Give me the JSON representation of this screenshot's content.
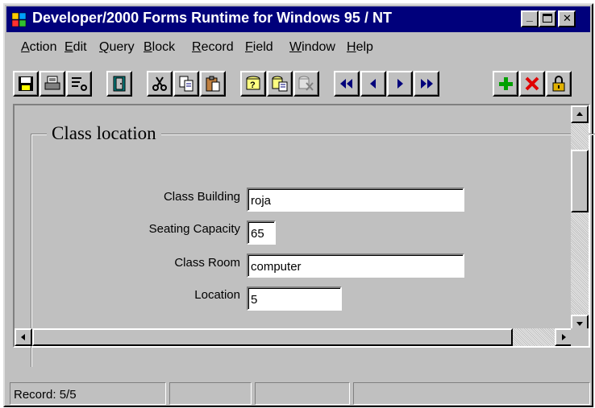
{
  "window": {
    "title": "Developer/2000 Forms Runtime for Windows 95 / NT",
    "minimize_glyph": "_",
    "maximize_glyph": "□",
    "close_glyph": "✕"
  },
  "menu": [
    "Action",
    "Edit",
    "Query",
    "Block",
    "Record",
    "Field",
    "Window",
    "Help"
  ],
  "toolbar": {
    "buttons": [
      {
        "name": "save",
        "icon": "floppy-disk-icon"
      },
      {
        "name": "print",
        "icon": "printer-icon"
      },
      {
        "name": "print-setup",
        "icon": "print-setup-icon"
      },
      {
        "name": "exit",
        "icon": "door-icon"
      },
      {
        "name": "cut",
        "icon": "scissors-icon"
      },
      {
        "name": "copy",
        "icon": "copy-icon"
      },
      {
        "name": "paste",
        "icon": "paste-icon"
      },
      {
        "name": "enter-query",
        "icon": "enter-query-icon"
      },
      {
        "name": "execute-query",
        "icon": "execute-query-icon"
      },
      {
        "name": "cancel-query",
        "icon": "cancel-query-icon"
      },
      {
        "name": "previous-block",
        "icon": "double-left-arrow-icon"
      },
      {
        "name": "previous-record",
        "icon": "left-arrow-icon"
      },
      {
        "name": "next-record",
        "icon": "right-arrow-icon"
      },
      {
        "name": "next-block",
        "icon": "double-right-arrow-icon"
      },
      {
        "name": "insert-record",
        "icon": "green-plus-icon"
      },
      {
        "name": "delete-record",
        "icon": "red-x-icon"
      },
      {
        "name": "lock-record",
        "icon": "padlock-icon"
      }
    ]
  },
  "form": {
    "frame_title": "Class location",
    "fields": {
      "class_building": {
        "label": "Class Building",
        "value": "roja"
      },
      "seating_capacity": {
        "label": "Seating  Capacity",
        "value": "65"
      },
      "class_room": {
        "label": "Class Room",
        "value": "computer"
      },
      "location": {
        "label": "Location",
        "value": "5"
      }
    }
  },
  "status": {
    "record": "Record: 5/5"
  },
  "colors": {
    "titlebar": "#00007b",
    "face": "#c0c0c0",
    "field_bg": "#ffffff"
  }
}
